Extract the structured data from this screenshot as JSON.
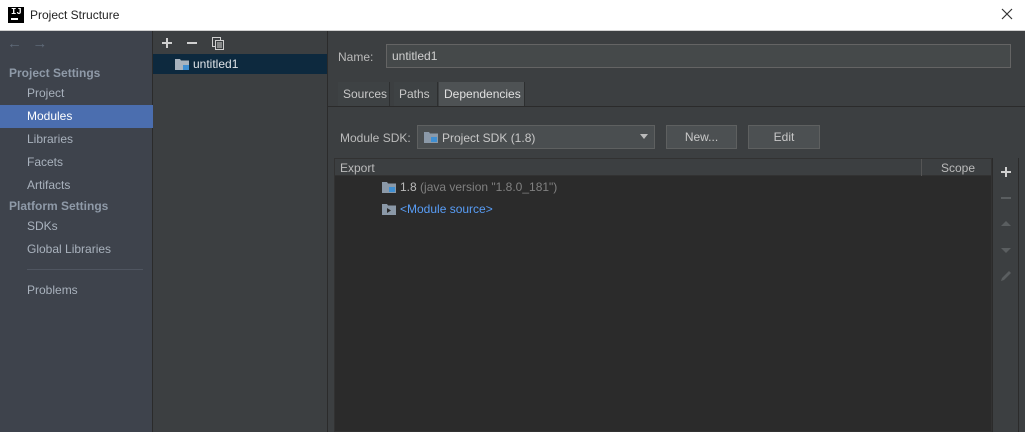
{
  "window": {
    "title": "Project Structure"
  },
  "nav": {
    "back_symbol": "←",
    "forward_symbol": "→"
  },
  "sidebar": {
    "project_settings_heading": "Project Settings",
    "project_items": [
      "Project",
      "Modules",
      "Libraries",
      "Facets",
      "Artifacts"
    ],
    "platform_settings_heading": "Platform Settings",
    "platform_items": [
      "SDKs",
      "Global Libraries"
    ],
    "problems": "Problems",
    "selected": "Modules"
  },
  "modules": {
    "items": [
      "untitled1"
    ]
  },
  "module": {
    "name_label": "Name:",
    "name_value": "untitled1",
    "tabs": [
      "Sources",
      "Paths",
      "Dependencies"
    ],
    "active_tab": "Dependencies",
    "sdk_label": "Module SDK:",
    "sdk_value": "Project SDK (1.8)",
    "new_button": "New...",
    "edit_button": "Edit"
  },
  "dependencies": {
    "columns": {
      "export": "Export",
      "scope": "Scope"
    },
    "rows": [
      {
        "name": "1.8",
        "note": "(java version \"1.8.0_181\")"
      },
      {
        "name": "<Module source>"
      }
    ]
  },
  "icons": {
    "logo": "intellij-logo-icon",
    "close": "close-icon",
    "add": "plus-icon",
    "remove": "minus-icon",
    "copy": "copy-icon",
    "folder": "folder-icon",
    "module": "module-folder-icon",
    "move_up": "arrow-up-icon",
    "move_down": "arrow-down-icon",
    "edit": "pencil-icon"
  },
  "colors": {
    "selection": "#4b6eaf",
    "link": "#589df6",
    "tree_selection": "#0d293e"
  }
}
